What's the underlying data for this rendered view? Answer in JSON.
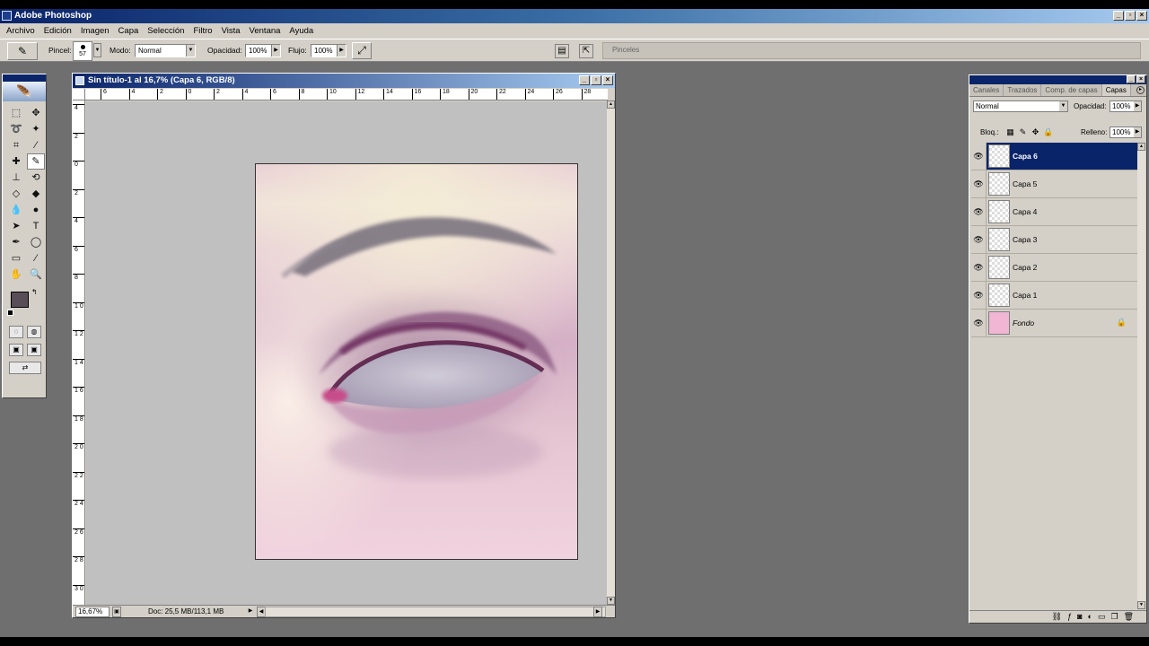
{
  "app": {
    "title": "Adobe Photoshop"
  },
  "window_buttons": {
    "minimize": "_",
    "maximize": "▫",
    "close": "×"
  },
  "menu": [
    "Archivo",
    "Edición",
    "Imagen",
    "Capa",
    "Selección",
    "Filtro",
    "Vista",
    "Ventana",
    "Ayuda"
  ],
  "options": {
    "brush_label": "Pincel:",
    "brush_size": "57",
    "mode_label": "Modo:",
    "mode_value": "Normal",
    "opacity_label": "Opacidad:",
    "opacity_value": "100%",
    "flow_label": "Flujo:",
    "flow_value": "100%",
    "palette_well_tab": "Pinceles"
  },
  "document": {
    "title": "Sin título-1 al 16,7% (Capa 6, RGB/8)",
    "zoom": "16,67%",
    "doc_info": "Doc: 25,5 MB/113,1 MB",
    "ruler_h": [
      "6",
      "4",
      "2",
      "0",
      "2",
      "4",
      "6",
      "8",
      "10",
      "12",
      "14",
      "16",
      "18",
      "20",
      "22",
      "24",
      "26",
      "28"
    ],
    "ruler_v": [
      "4",
      "2",
      "0",
      "2",
      "4",
      "6",
      "8",
      "1 0",
      "1 2",
      "1 4",
      "1 6",
      "1 8",
      "2 0",
      "2 2",
      "2 4",
      "2 6",
      "2 8",
      "3 0"
    ]
  },
  "layers_panel": {
    "tabs": [
      "Canales",
      "Trazados",
      "Comp. de capas",
      "Capas"
    ],
    "active_tab": "Capas",
    "blend_mode": "Normal",
    "opacity_label": "Opacidad:",
    "opacity_value": "100%",
    "lock_label": "Bloq.:",
    "fill_label": "Relleno:",
    "fill_value": "100%",
    "layers": [
      {
        "name": "Capa 6",
        "selected": true
      },
      {
        "name": "Capa 5",
        "selected": false
      },
      {
        "name": "Capa 4",
        "selected": false
      },
      {
        "name": "Capa 3",
        "selected": false
      },
      {
        "name": "Capa 2",
        "selected": false
      },
      {
        "name": "Capa 1",
        "selected": false
      },
      {
        "name": "Fondo",
        "selected": false,
        "locked": true,
        "color": "#f1b6d4"
      }
    ]
  },
  "toolbox": {
    "foreground_color": "#594e58",
    "background_color": "#ffffff"
  }
}
